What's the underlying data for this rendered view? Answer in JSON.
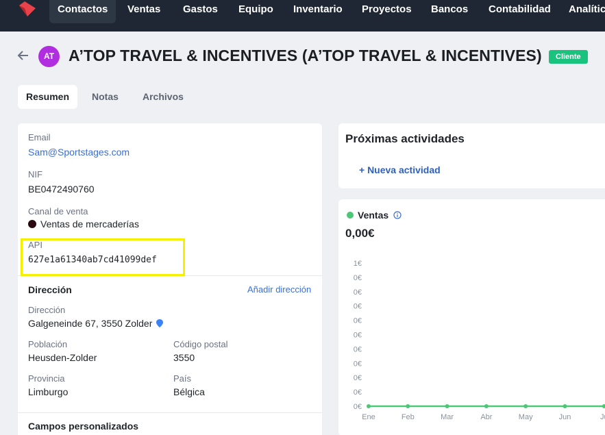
{
  "nav": {
    "items": [
      "Contactos",
      "Ventas",
      "Gastos",
      "Equipo",
      "Inventario",
      "Proyectos",
      "Bancos",
      "Contabilidad",
      "Analítica"
    ],
    "active": "Contactos",
    "logo_icon": "brand-logo-icon"
  },
  "header": {
    "avatar_initials": "AT",
    "avatar_color": "#b02ee0",
    "title": "A’TOP TRAVEL & INCENTIVES (A’TOP TRAVEL & INCENTIVES)",
    "badge": "Cliente",
    "badge_color": "#19c37d"
  },
  "tabs": [
    "Resumen",
    "Notas",
    "Archivos"
  ],
  "contact": {
    "email_label": "Email",
    "email": "Sam@Sportstages.com",
    "nif_label": "NIF",
    "nif": "BE0472490760",
    "channel_label": "Canal de venta",
    "channel": "Ventas de mercaderías",
    "api_label": "API",
    "api": "627e1a61340ab7cd41099def"
  },
  "address": {
    "section_title": "Dirección",
    "add_link": "Añadir dirección",
    "direccion_label": "Dirección",
    "direccion": "Galgeneinde 67, 3550 Zolder",
    "poblacion_label": "Población",
    "poblacion": "Heusden-Zolder",
    "cp_label": "Código postal",
    "cp": "3550",
    "provincia_label": "Provincia",
    "provincia": "Limburgo",
    "pais_label": "País",
    "pais": "Bélgica"
  },
  "custom_fields": {
    "title": "Campos personalizados"
  },
  "activities": {
    "title": "Próximas actividades",
    "new_button": "+ Nueva actividad"
  },
  "sales": {
    "label": "Ventas",
    "total": "0,00€",
    "color": "#4cc776"
  },
  "chart_data": {
    "type": "line",
    "categories": [
      "Ene",
      "Feb",
      "Mar",
      "Abr",
      "May",
      "Jun",
      "Ju"
    ],
    "series": [
      {
        "values": [
          0,
          0,
          0,
          0,
          0,
          0,
          0
        ]
      }
    ],
    "y_ticks": [
      "1€",
      "0€",
      "0€",
      "0€",
      "0€",
      "0€",
      "0€",
      "0€",
      "0€",
      "0€",
      "0€"
    ],
    "ylim": [
      0,
      1
    ],
    "grid": false
  }
}
